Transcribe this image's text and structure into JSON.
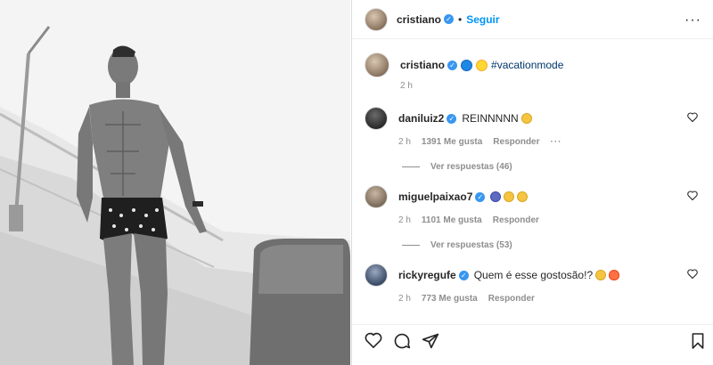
{
  "header": {
    "username": "cristiano",
    "separator": "•",
    "follow_label": "Seguir",
    "more": "···"
  },
  "caption": {
    "username": "cristiano",
    "hashtag": "#vacationmode",
    "time": "2 h",
    "emojis": [
      "wave-emoji",
      "sun-emoji"
    ]
  },
  "comments": [
    {
      "username": "daniluiz2",
      "text": "REINNNNN",
      "time": "2 h",
      "likes": "1391 Me gusta",
      "reply": "Responder",
      "more": "···",
      "view_replies": "Ver respuestas (46)"
    },
    {
      "username": "miguelpaixao7",
      "text": "",
      "time": "2 h",
      "likes": "1101 Me gusta",
      "reply": "Responder",
      "view_replies": "Ver respuestas (53)"
    },
    {
      "username": "rickyregufe",
      "text": "Quem é esse gostosão!?",
      "time": "2 h",
      "likes": "773 Me gusta",
      "reply": "Responder"
    }
  ],
  "colors": {
    "accent": "#0095f6",
    "verified": "#3897f0",
    "hashtag": "#00376b",
    "muted": "#8e8e8e"
  },
  "icons": {
    "post_more": "ellipsis-icon",
    "like": "heart-icon",
    "comment": "comment-icon",
    "share": "share-icon",
    "save": "bookmark-icon"
  }
}
